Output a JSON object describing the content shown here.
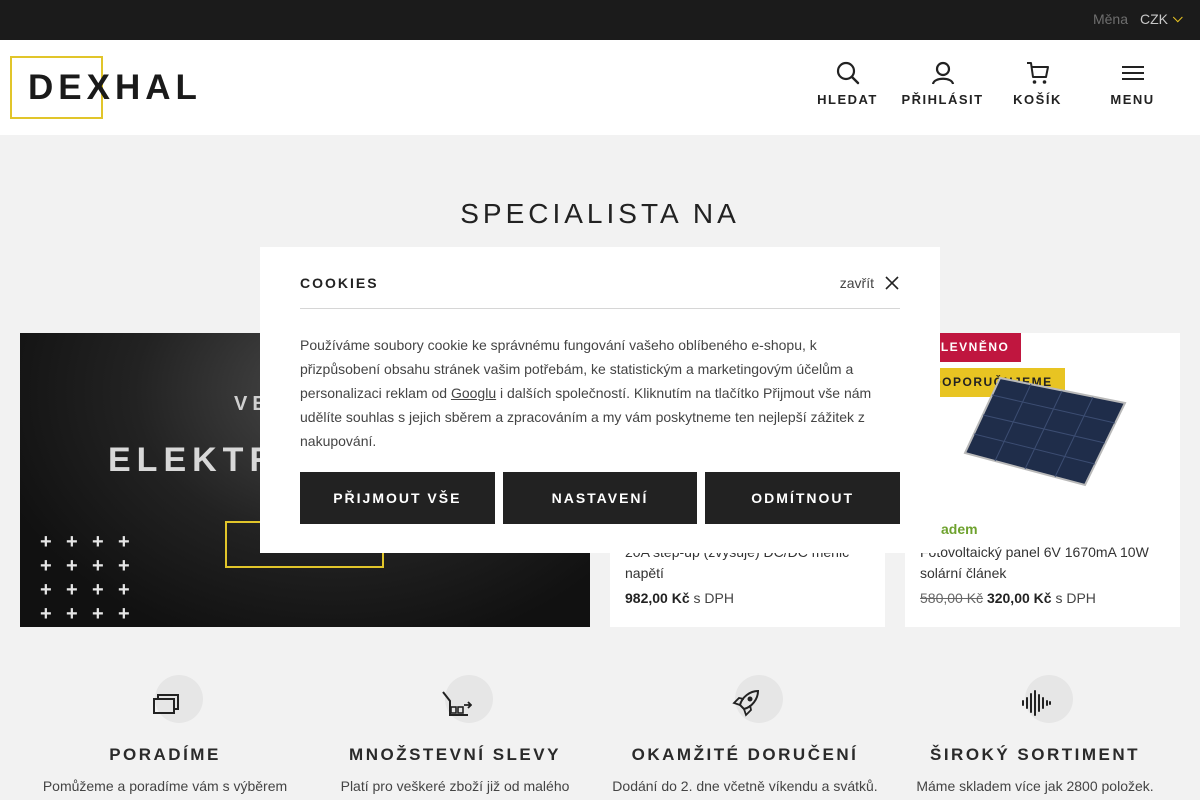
{
  "topbar": {
    "currency_label": "Měna",
    "currency_value": "CZK"
  },
  "brand": {
    "logo_text": "DEXHAL"
  },
  "nav": {
    "search": "HLEDAT",
    "login": "PŘIHLÁSIT",
    "cart": "KOŠÍK",
    "menu": "MENU"
  },
  "hero": {
    "title": "SPECIALISTA NA"
  },
  "banner": {
    "subtitle": "VE",
    "title": "ELEKTR"
  },
  "products": [
    {
      "stock": "",
      "name": "20A step-up (zvyšuje) DC/DC měnič napětí",
      "price": "982,00 Kč",
      "vat": "s DPH"
    },
    {
      "badge_sale": "ZLEVNĚNO",
      "badge_recommend": "DOPORUČUJEME",
      "stock": "Skladem",
      "name": "Fotovoltaický panel 6V 1670mA 10W solární článek",
      "old_price": "580,00 Kč",
      "price": "320,00 Kč",
      "vat": "s DPH"
    }
  ],
  "features": [
    {
      "icon": "chat-icon",
      "title": "PORADÍME",
      "text": "Pomůžeme a poradíme vám s výběrem"
    },
    {
      "icon": "discount-chart-icon",
      "title": "MNOŽSTEVNÍ SLEVY",
      "text": "Platí pro veškeré zboží již od malého"
    },
    {
      "icon": "rocket-icon",
      "title": "OKAMŽITÉ DORUČENÍ",
      "text": "Dodání do 2. dne včetně víkendu a svátků."
    },
    {
      "icon": "soundwave-icon",
      "title": "ŠIROKÝ SORTIMENT",
      "text": "Máme skladem více jak 2800 položek."
    }
  ],
  "cookies": {
    "title": "COOKIES",
    "close_label": "zavřít",
    "text_before_link": "Používáme soubory cookie ke správnému fungování vašeho oblíbeného e-shopu, k přizpůsobení obsahu stránek vašim potřebám, ke statistickým a marketingovým účelům a personalizaci reklam od ",
    "link_text": "Googlu",
    "text_after_link": " i dalších společností. Kliknutím na tlačítko Přijmout vše nám udělíte souhlas s jejich sběrem a zpracováním a my vám poskytneme ten nejlepší zážitek z nakupování.",
    "accept_all": "PŘIJMOUT VŠE",
    "settings": "NASTAVENÍ",
    "reject": "ODMÍTNOUT"
  },
  "colors": {
    "accent": "#e1c52a",
    "sale": "#c0163f",
    "recommend": "#e8c422",
    "in_stock": "#6ea22e",
    "dark": "#1b1b1b"
  }
}
